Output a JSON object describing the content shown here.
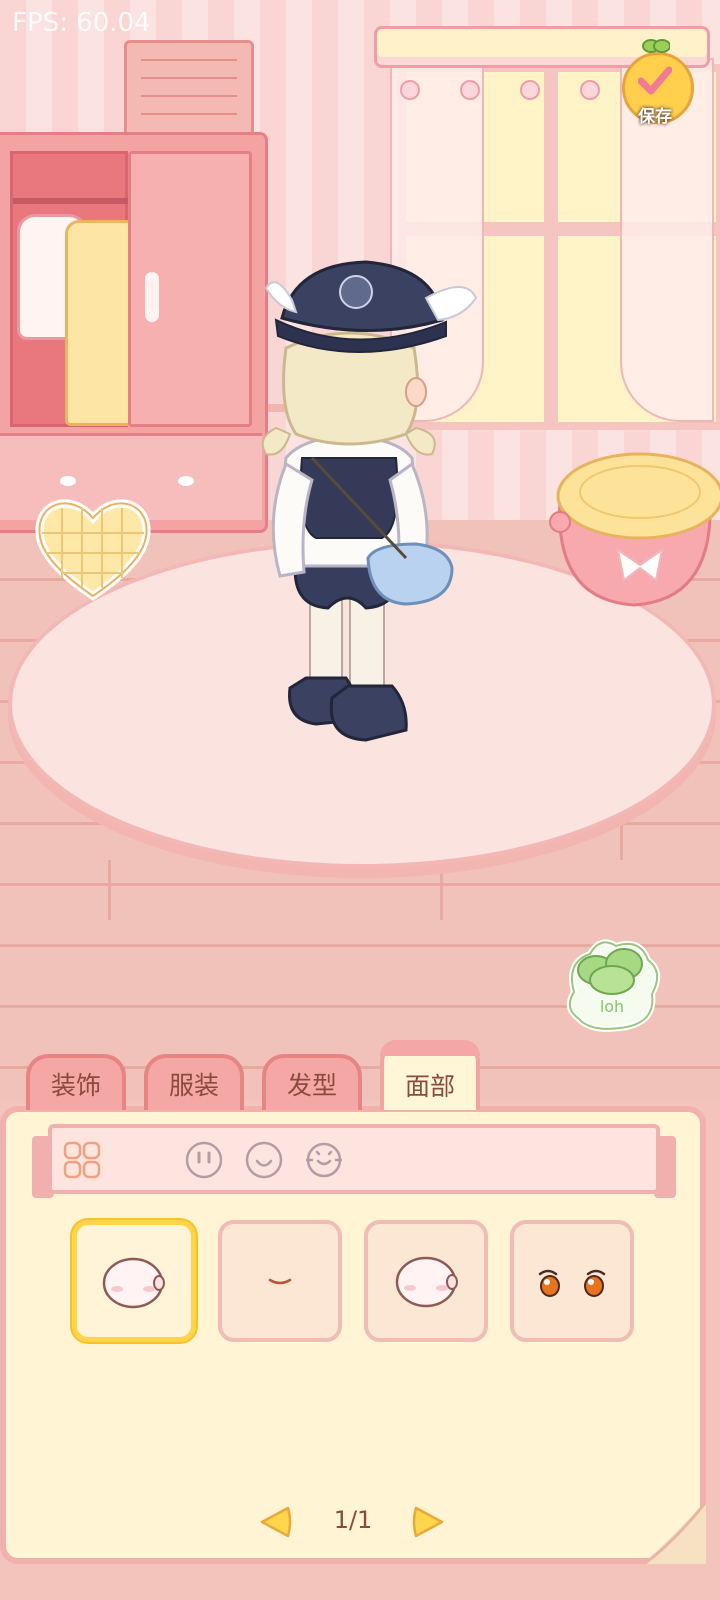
{
  "hud": {
    "fps": "FPS: 60.04"
  },
  "header": {
    "save_label": "保存"
  },
  "tabs": [
    {
      "label": "装饰",
      "active": false
    },
    {
      "label": "服装",
      "active": false
    },
    {
      "label": "发型",
      "active": false
    },
    {
      "label": "面部",
      "active": true
    }
  ],
  "subcategories": [
    "grid-all-icon",
    "face-eyes-icon",
    "face-mouth-icon",
    "face-blush-icon"
  ],
  "items": [
    {
      "icon": "face-blank-icon",
      "selected": true
    },
    {
      "icon": "mouth-smile-icon",
      "selected": false
    },
    {
      "icon": "face-blank-icon",
      "selected": false
    },
    {
      "icon": "eyes-orange-icon",
      "selected": false
    }
  ],
  "pager": {
    "text": "1/1"
  },
  "colors": {
    "accent_tab": "#f4a7a5",
    "panel_bg": "#fff4d4",
    "selected_border": "#ffd44a",
    "text_brown": "#8a4a3c"
  }
}
